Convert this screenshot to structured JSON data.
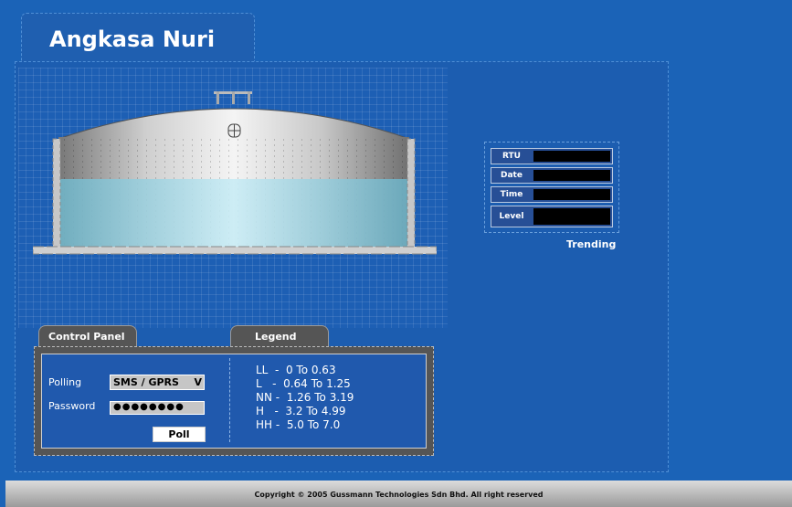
{
  "app": {
    "title": "Angkasa Nuri"
  },
  "info_panel": {
    "rows": [
      {
        "label": "RTU",
        "value": ""
      },
      {
        "label": "Date",
        "value": ""
      },
      {
        "label": "Time",
        "value": ""
      },
      {
        "label": "Level",
        "value": ""
      }
    ],
    "trending_label": "Trending"
  },
  "tabs": {
    "control_panel": "Control Panel",
    "legend": "Legend"
  },
  "control_panel": {
    "polling_label": "Polling",
    "polling_value": "SMS / GPRS",
    "password_label": "Password",
    "password_value": "●●●●●●●●",
    "poll_button": "Poll"
  },
  "legend": {
    "items": [
      "LL  -  0 To 0.63",
      "L   -  0.64 To 1.25",
      "NN -  1.26 To 3.19",
      "H   -  3.2 To 4.99",
      "HH -  5.0 To 7.0"
    ]
  },
  "tank": {
    "fill_level": 0.62,
    "water_color": "#a9dbe9"
  },
  "footer": {
    "copyright": "Copyright © 2005 Gussmann Technologies Sdn Bhd. All right reserved"
  }
}
